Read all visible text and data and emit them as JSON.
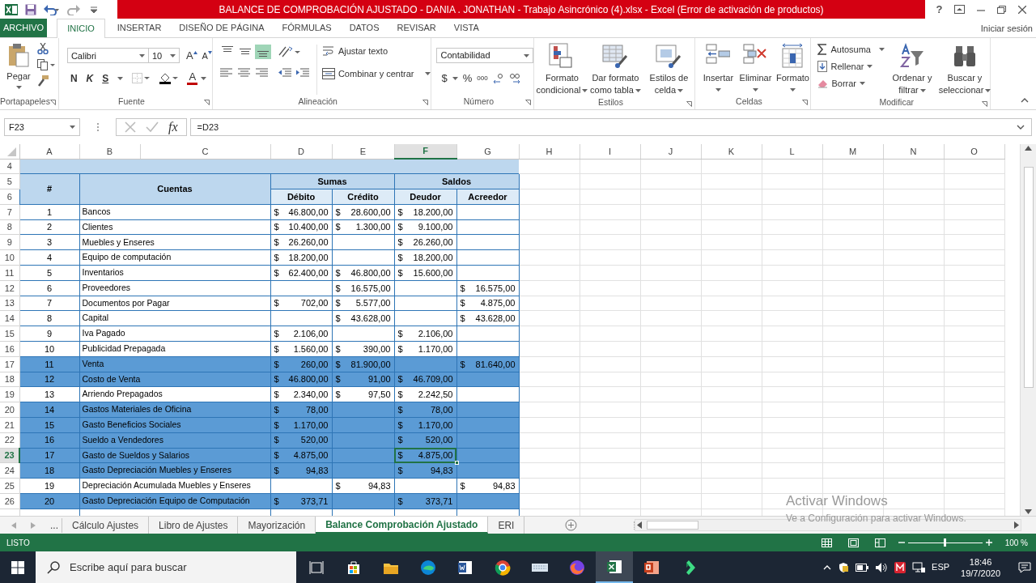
{
  "title_bar": {
    "title": "BALANCE DE COMPROBACIÓN AJUSTADO - DANIA . JONATHAN - Trabajo Asincrónico (4).xlsx -  Excel (Error de activación de productos)",
    "help": "?"
  },
  "ribbon_tabs": [
    {
      "label": "ARCHIVO",
      "kind": "file",
      "selected": false
    },
    {
      "label": "INICIO",
      "kind": "tab",
      "selected": true
    },
    {
      "label": "INSERTAR",
      "kind": "tab",
      "selected": false
    },
    {
      "label": "DISEÑO DE PÁGINA",
      "kind": "tab",
      "selected": false
    },
    {
      "label": "FÓRMULAS",
      "kind": "tab",
      "selected": false
    },
    {
      "label": "DATOS",
      "kind": "tab",
      "selected": false
    },
    {
      "label": "REVISAR",
      "kind": "tab",
      "selected": false
    },
    {
      "label": "VISTA",
      "kind": "tab",
      "selected": false
    }
  ],
  "sign_in": "Iniciar sesión",
  "ribbon": {
    "clipboard": {
      "label": "Portapapeles",
      "paste": "Pegar"
    },
    "font": {
      "label": "Fuente",
      "font_name": "Calibri",
      "font_size": "10",
      "grow": "A",
      "shrink": "A",
      "bold": "N",
      "italic": "K",
      "underline": "S",
      "font_color": "A"
    },
    "alignment": {
      "label": "Alineación",
      "vertical_alignment": [
        {
          "selected": false
        },
        {
          "selected": false
        },
        {
          "selected": true
        }
      ],
      "wrap": "Ajustar texto",
      "merge": "Combinar y centrar"
    },
    "number": {
      "label": "Número",
      "format": "Contabilidad",
      "currency": "$",
      "percent": "%",
      "thousands": "000"
    },
    "styles": {
      "label": "Estilos",
      "buttons": [
        {
          "kind": "conditional",
          "lines": [
            "Formato",
            "condicional"
          ]
        },
        {
          "kind": "table",
          "lines": [
            "Dar formato",
            "como tabla"
          ]
        },
        {
          "kind": "cell",
          "lines": [
            "Estilos de",
            "celda"
          ]
        }
      ]
    },
    "cells": {
      "label": "Celdas",
      "buttons": [
        {
          "kind": "insert",
          "label": "Insertar"
        },
        {
          "kind": "delete",
          "label": "Eliminar"
        },
        {
          "kind": "format",
          "label": "Formato"
        }
      ]
    },
    "editing": {
      "label": "Modificar",
      "autosum": "Autosuma",
      "fill": "Rellenar",
      "clear": "Borrar",
      "sort": [
        "Ordenar y",
        "filtrar"
      ],
      "find": [
        "Buscar y",
        "seleccionar"
      ]
    }
  },
  "formula_bar": {
    "name_box": "F23",
    "fx": "fx",
    "formula": "=D23"
  },
  "sheet": {
    "columns": [
      {
        "label": "A",
        "selected": false
      },
      {
        "label": "B",
        "selected": false
      },
      {
        "label": "C",
        "selected": false
      },
      {
        "label": "D",
        "selected": false
      },
      {
        "label": "E",
        "selected": false
      },
      {
        "label": "F",
        "selected": true
      },
      {
        "label": "G",
        "selected": false
      },
      {
        "label": "H",
        "selected": false
      },
      {
        "label": "I",
        "selected": false
      },
      {
        "label": "J",
        "selected": false
      },
      {
        "label": "K",
        "selected": false
      },
      {
        "label": "L",
        "selected": false
      },
      {
        "label": "M",
        "selected": false
      },
      {
        "label": "N",
        "selected": false
      },
      {
        "label": "O",
        "selected": false
      }
    ],
    "header_rows": [
      "4",
      "5",
      "6"
    ],
    "headers": {
      "n": "#",
      "account": "Cuentas",
      "sums": "Sumas",
      "balances": "Saldos",
      "debit": "Débito",
      "credit": "Crédito",
      "debtor": "Deudor",
      "creditor": "Acreedor"
    },
    "rows": [
      {
        "row": "7",
        "n": "1",
        "account": "Bancos",
        "debit": "$ 46.800,00",
        "credit": "$ 28.600,00",
        "debtor": "$ 18.200,00",
        "highlighted": false,
        "selected": false
      },
      {
        "row": "8",
        "n": "2",
        "account": "Clientes",
        "debit": "$ 10.400,00",
        "credit": "$ 1.300,00",
        "debtor": "$ 9.100,00",
        "highlighted": false,
        "selected": false
      },
      {
        "row": "9",
        "n": "3",
        "account": "Muebles y Enseres",
        "debit": "$ 26.260,00",
        "debtor": "$ 26.260,00",
        "highlighted": false,
        "selected": false
      },
      {
        "row": "10",
        "n": "4",
        "account": "Equipo de computación",
        "debit": "$ 18.200,00",
        "debtor": "$ 18.200,00",
        "highlighted": false,
        "selected": false
      },
      {
        "row": "11",
        "n": "5",
        "account": "Inventarios",
        "debit": "$ 62.400,00",
        "credit": "$ 46.800,00",
        "debtor": "$ 15.600,00",
        "highlighted": false,
        "selected": false
      },
      {
        "row": "12",
        "n": "6",
        "account": "Proveedores",
        "credit": "$ 16.575,00",
        "creditor": "$ 16.575,00",
        "highlighted": false,
        "selected": false
      },
      {
        "row": "13",
        "n": "7",
        "account": "Documentos por Pagar",
        "debit": "$ 702,00",
        "credit": "$ 5.577,00",
        "creditor": "$ 4.875,00",
        "highlighted": false,
        "selected": false
      },
      {
        "row": "14",
        "n": "8",
        "account": "Capital",
        "credit": "$ 43.628,00",
        "creditor": "$ 43.628,00",
        "highlighted": false,
        "selected": false
      },
      {
        "row": "15",
        "n": "9",
        "account": "Iva Pagado",
        "debit": "$ 2.106,00",
        "debtor": "$ 2.106,00",
        "highlighted": false,
        "selected": false
      },
      {
        "row": "16",
        "n": "10",
        "account": "Publicidad Prepagada",
        "debit": "$ 1.560,00",
        "credit": "$ 390,00",
        "debtor": "$ 1.170,00",
        "highlighted": false,
        "selected": false
      },
      {
        "row": "17",
        "n": "11",
        "account": "Venta",
        "debit": "$ 260,00",
        "credit": "$ 81.900,00",
        "creditor": "$ 81.640,00",
        "highlighted": true,
        "selected": false
      },
      {
        "row": "18",
        "n": "12",
        "account": "Costo de Venta",
        "debit": "$ 46.800,00",
        "credit": "$ 91,00",
        "debtor": "$ 46.709,00",
        "highlighted": true,
        "selected": false
      },
      {
        "row": "19",
        "n": "13",
        "account": "Arriendo Prepagados",
        "debit": "$ 2.340,00",
        "credit": "$ 97,50",
        "debtor": "$ 2.242,50",
        "highlighted": false,
        "selected": false
      },
      {
        "row": "20",
        "n": "14",
        "account": "Gastos Materiales de Oficina",
        "debit": "$ 78,00",
        "debtor": "$ 78,00",
        "highlighted": true,
        "selected": false
      },
      {
        "row": "21",
        "n": "15",
        "account": "Gasto Beneficios Sociales",
        "debit": "$ 1.170,00",
        "debtor": "$ 1.170,00",
        "highlighted": true,
        "selected": false
      },
      {
        "row": "22",
        "n": "16",
        "account": "Sueldo a Vendedores",
        "debit": "$ 520,00",
        "debtor": "$ 520,00",
        "highlighted": true,
        "selected": false
      },
      {
        "row": "23",
        "n": "17",
        "account": "Gasto de Sueldos y Salarios",
        "debit": "$ 4.875,00",
        "debtor": "$ 4.875,00",
        "highlighted": true,
        "selected": true
      },
      {
        "row": "24",
        "n": "18",
        "account": "Gasto Depreciación Muebles y Enseres",
        "debit": "$ 94,83",
        "debtor": "$ 94,83",
        "highlighted": true,
        "selected": false
      },
      {
        "row": "25",
        "n": "19",
        "account": "Depreciación Acumulada Muebles y Enseres",
        "credit": "$ 94,83",
        "creditor": "$ 94,83",
        "highlighted": false,
        "selected": false
      },
      {
        "row": "26",
        "n": "20",
        "account": "Gasto Depreciación Equipo de Computación",
        "debit": "$ 373,71",
        "debtor": "$ 373,71",
        "highlighted": true,
        "selected": false
      }
    ]
  },
  "sheet_tabs": {
    "more": "...",
    "tabs": [
      {
        "label": "Cálculo Ajustes",
        "selected": false
      },
      {
        "label": "Libro de Ajustes",
        "selected": false
      },
      {
        "label": "Mayorización",
        "selected": false
      },
      {
        "label": "Balance Comprobación Ajustado",
        "selected": true
      },
      {
        "label": "ERI",
        "selected": false
      }
    ]
  },
  "status_bar": {
    "status": "LISTO",
    "zoom_slider": {
      "level": 0.5
    },
    "zoom": "100 %"
  },
  "activation_notice": {
    "title": "Activar Windows",
    "text": "Ve a Configuración para activar Windows."
  },
  "taskbar": {
    "search_placeholder": "Escribe aquí para buscar",
    "language": "ESP",
    "time": "18:46",
    "date": "19/7/2020"
  }
}
